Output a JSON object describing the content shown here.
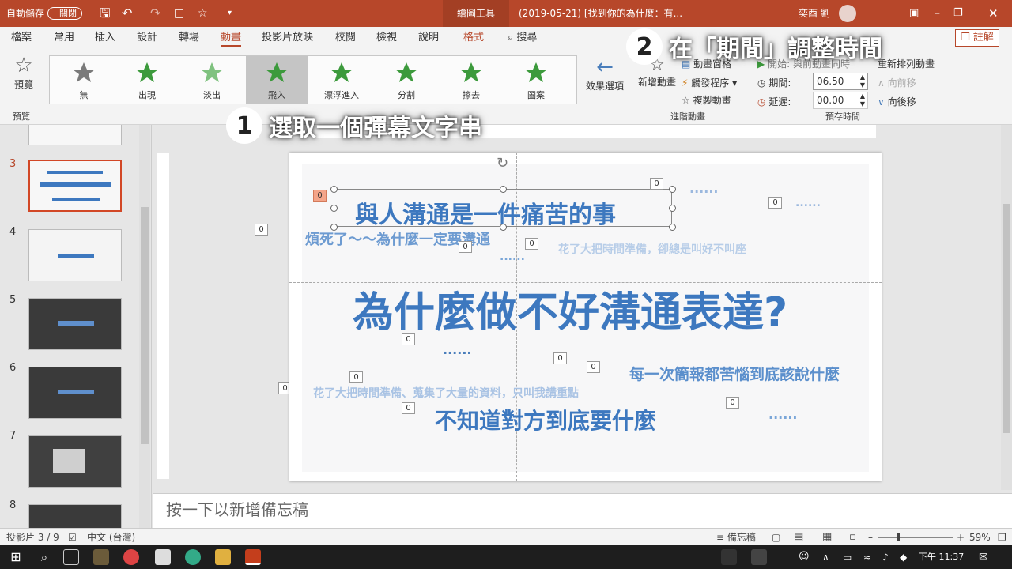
{
  "titlebar": {
    "autosave_label": "自動儲存",
    "autosave_state": "關閉",
    "context_tool": "繪圖工具",
    "doc_title": "(2019-05-21) [找到你的為什麼：有...",
    "user_name": "奕酉 劉"
  },
  "ribbon_tabs": [
    "檔案",
    "常用",
    "插入",
    "設計",
    "轉場",
    "動畫",
    "投影片放映",
    "校閱",
    "檢視",
    "說明",
    "格式"
  ],
  "ribbon_search": "搜尋",
  "ribbon_comment": "註解",
  "ribbon": {
    "preview_label": "預覽",
    "preview_group": "預覽",
    "animations": [
      "無",
      "出現",
      "淡出",
      "飛入",
      "漂浮進入",
      "分割",
      "擦去",
      "圖案"
    ],
    "selected_animation": "飛入",
    "effect_options": "效果選項",
    "add_animation": "新增動畫",
    "animation_pane": "動畫窗格",
    "trigger": "觸發程序",
    "animation_painter": "複製動畫",
    "advanced_group": "進階動畫",
    "start_label": "開始:",
    "start_value": "與前動畫同時",
    "duration_label": "期間:",
    "duration_value": "06.50",
    "delay_label": "延遲:",
    "delay_value": "00.00",
    "reorder_label": "重新排列動畫",
    "move_earlier": "向前移",
    "move_later": "向後移",
    "timing_group": "預存時間"
  },
  "callouts": {
    "step1_num": "1",
    "step1_text": "選取一個彈幕文字串",
    "step2_num": "2",
    "step2_text": "在「期間」調整時間"
  },
  "thumbnails": [
    {
      "num": "3",
      "selected": true
    },
    {
      "num": "4",
      "selected": false
    },
    {
      "num": "5",
      "selected": false
    },
    {
      "num": "6",
      "selected": false
    },
    {
      "num": "7",
      "selected": false
    },
    {
      "num": "8",
      "selected": false
    }
  ],
  "slide": {
    "title": "為什麼做不好溝通表達?",
    "selected_text": "與人溝通是一件痛苦的事",
    "texts": [
      {
        "text": "煩死了～～為什麼一定要溝通",
        "size": 18,
        "color": "#6d9bd1"
      },
      {
        "text": "花了大把時間準備，卻總是叫好不叫座",
        "size": 14,
        "color": "#b7cde8"
      },
      {
        "text": "每一次簡報都苦惱到底該說什麼",
        "size": 19,
        "color": "#5b8fcc"
      },
      {
        "text": "花了大把時間準備、蒐集了大量的資料，只叫我講重點",
        "size": 14,
        "color": "#a9c3e4"
      },
      {
        "text": "不知道對方到底要什麼",
        "size": 28,
        "color": "#3d78bf"
      }
    ],
    "dots": "......",
    "anim_tags": [
      "0",
      "0",
      "0",
      "0",
      "0",
      "0",
      "0",
      "0",
      "0",
      "0",
      "0",
      "0",
      "0"
    ]
  },
  "notes_placeholder": "按一下以新增備忘稿",
  "statusbar": {
    "slide_info": "投影片 3 / 9",
    "language": "中文 (台灣)",
    "notes_btn": "備忘稿",
    "zoom": "59%"
  },
  "taskbar": {
    "time": "下午 11:37"
  }
}
